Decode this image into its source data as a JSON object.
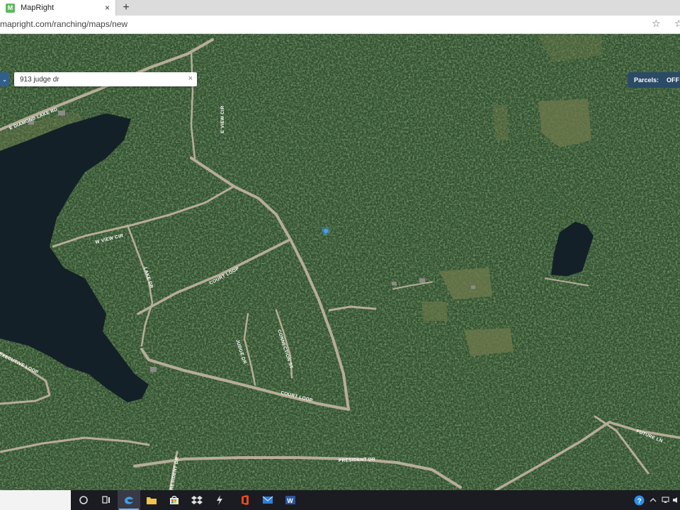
{
  "browser": {
    "tab_title": "MapRight",
    "favicon_letter": "M",
    "tab_close": "×",
    "new_tab": "+",
    "url": "mapright.com/ranching/maps/new",
    "favorite_glyph": "☆",
    "favorites_bar_glyph": "☆"
  },
  "map": {
    "menu_glyph": "⌄",
    "search_value": "913 judge dr",
    "search_clear": "×",
    "parcels_label": "Parcels:",
    "parcels_value": "OFF",
    "road_labels": {
      "diamond": "E DIAMOND LAKE RD",
      "eview": "E VIEW CIR",
      "wview": "W VIEW CIR",
      "lake": "LAKE DR",
      "courtloop_upper": "COURT LOOP",
      "judge": "JUDGE DR",
      "connection": "CONNECTION ST",
      "courtloop_lower": "COURT LOOP",
      "executive": "EXECUTIVE LOOP",
      "president": "PRESIDENT DR",
      "resident": "RESIDENT DR",
      "future": "FUTURE LN"
    },
    "colors": {
      "forest": "#2c4a2a",
      "water": "#142027",
      "road": "#b7ad96",
      "marker": "#4a9ee8"
    }
  },
  "taskbar": {
    "icons": [
      "cortana-icon",
      "task-view-icon",
      "edge-icon",
      "file-explorer-icon",
      "store-icon",
      "dropbox-icon",
      "app-icon",
      "office-icon",
      "mail-icon",
      "word-icon"
    ]
  }
}
